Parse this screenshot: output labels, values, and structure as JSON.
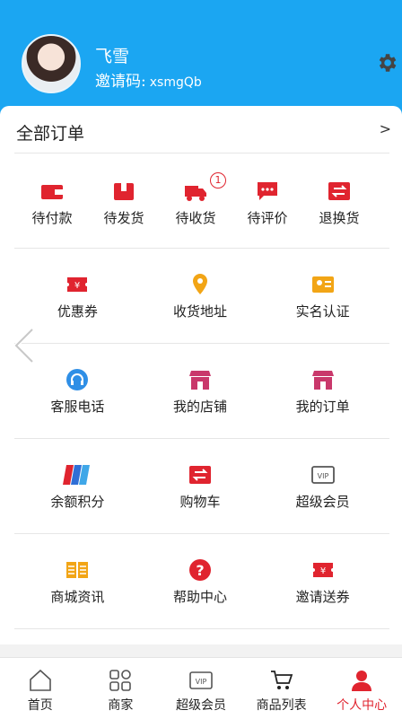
{
  "profile": {
    "username": "飞雪",
    "invite_label": "邀请码:",
    "invite_code": "xsmgQb"
  },
  "orders": {
    "title": "全部订单",
    "more": ">",
    "items": [
      {
        "label": "待付款",
        "icon": "wallet-icon"
      },
      {
        "label": "待发货",
        "icon": "box-icon"
      },
      {
        "label": "待收货",
        "icon": "truck-icon",
        "badge": "1"
      },
      {
        "label": "待评价",
        "icon": "comment-icon"
      },
      {
        "label": "退换货",
        "icon": "exchange-icon"
      }
    ]
  },
  "grid": [
    [
      {
        "label": "优惠券",
        "icon": "coupon-icon"
      },
      {
        "label": "收货地址",
        "icon": "location-pin-icon"
      },
      {
        "label": "实名认证",
        "icon": "id-card-icon"
      }
    ],
    [
      {
        "label": "客服电话",
        "icon": "headset-icon"
      },
      {
        "label": "我的店铺",
        "icon": "store-icon"
      },
      {
        "label": "我的订单",
        "icon": "store-order-icon"
      }
    ],
    [
      {
        "label": "余额积分",
        "icon": "balance-cards-icon"
      },
      {
        "label": "购物车",
        "icon": "cart-exchange-icon"
      },
      {
        "label": "超级会员",
        "icon": "vip-icon"
      }
    ],
    [
      {
        "label": "商城资讯",
        "icon": "book-icon"
      },
      {
        "label": "帮助中心",
        "icon": "help-icon"
      },
      {
        "label": "邀请送券",
        "icon": "invite-coupon-icon"
      }
    ]
  ],
  "tabs": [
    {
      "label": "首页",
      "icon": "home-icon"
    },
    {
      "label": "商家",
      "icon": "merchant-grid-icon"
    },
    {
      "label": "超级会员",
      "icon": "vip-icon"
    },
    {
      "label": "商品列表",
      "icon": "cart-icon"
    },
    {
      "label": "个人中心",
      "icon": "person-icon",
      "active": true
    }
  ],
  "colors": {
    "header_blue": "#1ba6f2",
    "accent_red": "#e0242f",
    "pin_orange": "#f2a516",
    "store_pink": "#c9386b"
  }
}
